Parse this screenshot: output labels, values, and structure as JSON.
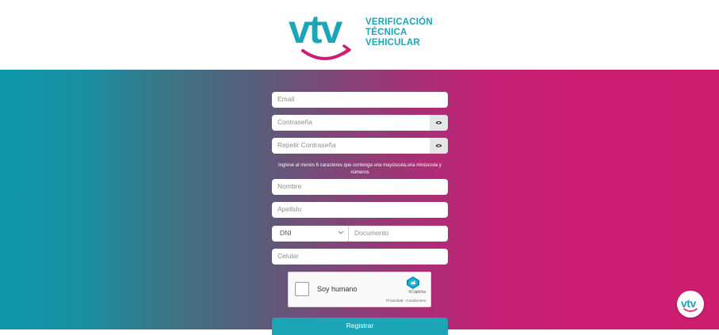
{
  "brand": {
    "mark": "vtv",
    "line1": "VERIFICACIÓN",
    "line2": "TÉCNICA",
    "line3": "VEHICULAR",
    "primary_color": "#1aa6b7",
    "accent_color": "#cd1e72"
  },
  "form": {
    "email_placeholder": "Email",
    "password_placeholder": "Contraseña",
    "repeat_password_placeholder": "Repetir Contraseña",
    "password_hint": "Ingrese al menos 6 caracteres que contenga una mayúscula,una minúscula y números",
    "name_placeholder": "Nombre",
    "surname_placeholder": "Apellido",
    "doc_type_value": "DNI",
    "document_placeholder": "Documento",
    "phone_placeholder": "Celular",
    "submit_label": "Registrar"
  },
  "captcha": {
    "label": "Soy humano",
    "brand": "hCaptcha",
    "links": "Privacidad - Condiciones"
  },
  "icons": {
    "password_toggle": "eye-icon",
    "repeat_password_toggle": "eye-icon",
    "doc_type_arrow": "chevron-down-icon",
    "captcha_logo": "hcaptcha-logo-icon",
    "corner": "vtv-logo-icon"
  }
}
